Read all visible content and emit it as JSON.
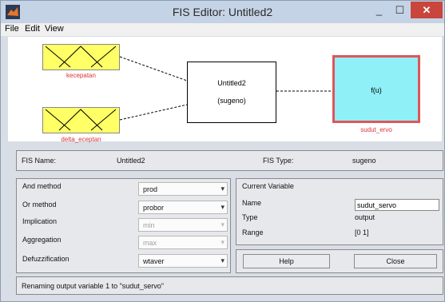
{
  "window": {
    "title": "FIS Editor: Untitled2"
  },
  "titlebar_buttons": {
    "minimize": "_",
    "maximize": "☐",
    "close": "✕"
  },
  "menu": [
    "File",
    "Edit",
    "View"
  ],
  "diagram": {
    "inputs": [
      {
        "name": "kecepatan"
      },
      {
        "name": "delta_eceptan"
      }
    ],
    "system": {
      "name": "Untitled2",
      "type": "(sugeno)"
    },
    "output": {
      "function": "f(u)",
      "name": "sudut_ervo"
    },
    "colors": {
      "input_fill": "#ffff66",
      "output_fill": "#8ff0f7",
      "output_border": "#e0555a",
      "label": "#dd3333"
    }
  },
  "fis_info": {
    "name_label": "FIS Name:",
    "name_value": "Untitled2",
    "type_label": "FIS Type:",
    "type_value": "sugeno"
  },
  "methods": {
    "and": {
      "label": "And method",
      "value": "prod"
    },
    "or": {
      "label": "Or method",
      "value": "probor"
    },
    "implication": {
      "label": "Implication",
      "value": "min"
    },
    "aggregation": {
      "label": "Aggregation",
      "value": "max"
    },
    "defuzz": {
      "label": "Defuzzification",
      "value": "wtaver"
    }
  },
  "current_variable": {
    "header": "Current Variable",
    "name_label": "Name",
    "name_value": "sudut_servo",
    "type_label": "Type",
    "type_value": "output",
    "range_label": "Range",
    "range_value": "[0 1]"
  },
  "buttons": {
    "help": "Help",
    "close": "Close"
  },
  "status": "Renaming output variable 1 to \"sudut_servo\""
}
